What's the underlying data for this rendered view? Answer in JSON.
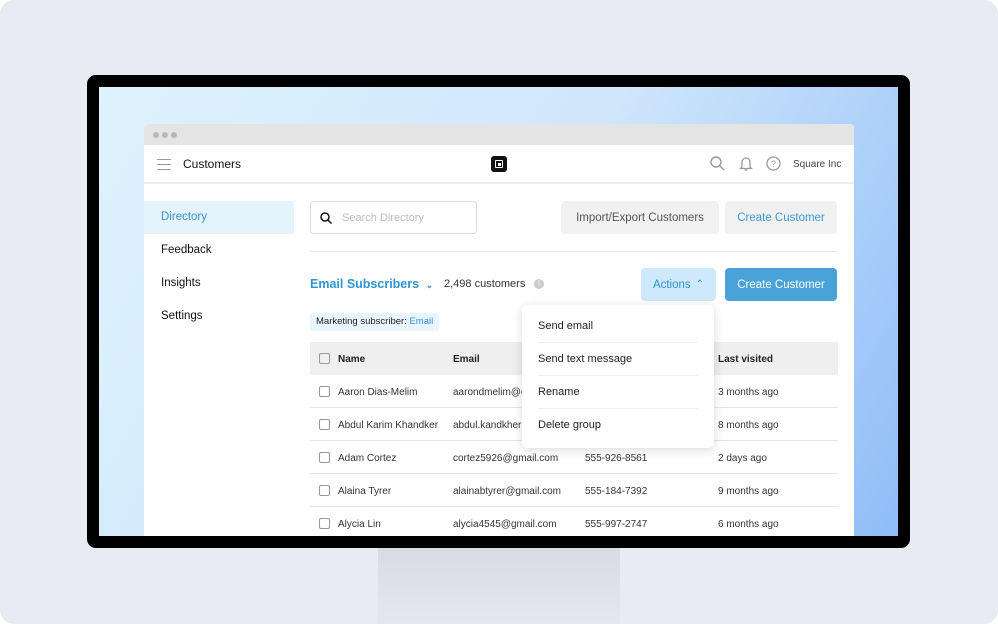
{
  "app": {
    "title": "Customers",
    "org": "Square Inc"
  },
  "icons": {
    "menu": "hamburger-icon",
    "logo": "square-logo",
    "search": "search-icon",
    "bell": "bell-icon",
    "help": "help-icon"
  },
  "sidebar": {
    "items": [
      {
        "label": "Directory",
        "active": true
      },
      {
        "label": "Feedback"
      },
      {
        "label": "Insights"
      },
      {
        "label": "Settings"
      }
    ]
  },
  "toolbar": {
    "search_placeholder": "Search Directory",
    "import_label": "Import/Export Customers",
    "create_label": "Create Customer"
  },
  "group": {
    "name": "Email Subscribers",
    "count": "2,498 customers",
    "actions_label": "Actions",
    "create_label": "Create Customer",
    "filter_key": "Marketing subscriber:",
    "filter_value": "Email"
  },
  "actions_menu": [
    "Send email",
    "Send text message",
    "Rename",
    "Delete group"
  ],
  "table": {
    "headers": {
      "name": "Name",
      "email": "Email",
      "last": "Last visited"
    },
    "rows": [
      {
        "name": "Aaron Dias-Melim",
        "email": "aarondmelim@g",
        "phone": "",
        "last": "3 months ago"
      },
      {
        "name": "Abdul Karim Khandker",
        "email": "abdul.kandkher",
        "phone": "",
        "last": "8 months ago"
      },
      {
        "name": "Adam Cortez",
        "email": "cortez5926@gmail.com",
        "phone": "555-926-8561",
        "last": "2 days ago"
      },
      {
        "name": "Alaina Tyrer",
        "email": "alainabtyrer@gmail.com",
        "phone": "555-184-7392",
        "last": "9 months ago"
      },
      {
        "name": "Alycia Lin",
        "email": "alycia4545@gmail.com",
        "phone": "555-997-2747",
        "last": "6 months ago"
      }
    ]
  },
  "colors": {
    "accent": "#2d95d3",
    "primary_button": "#4aa3d8",
    "actions_button": "#cde9fb"
  }
}
